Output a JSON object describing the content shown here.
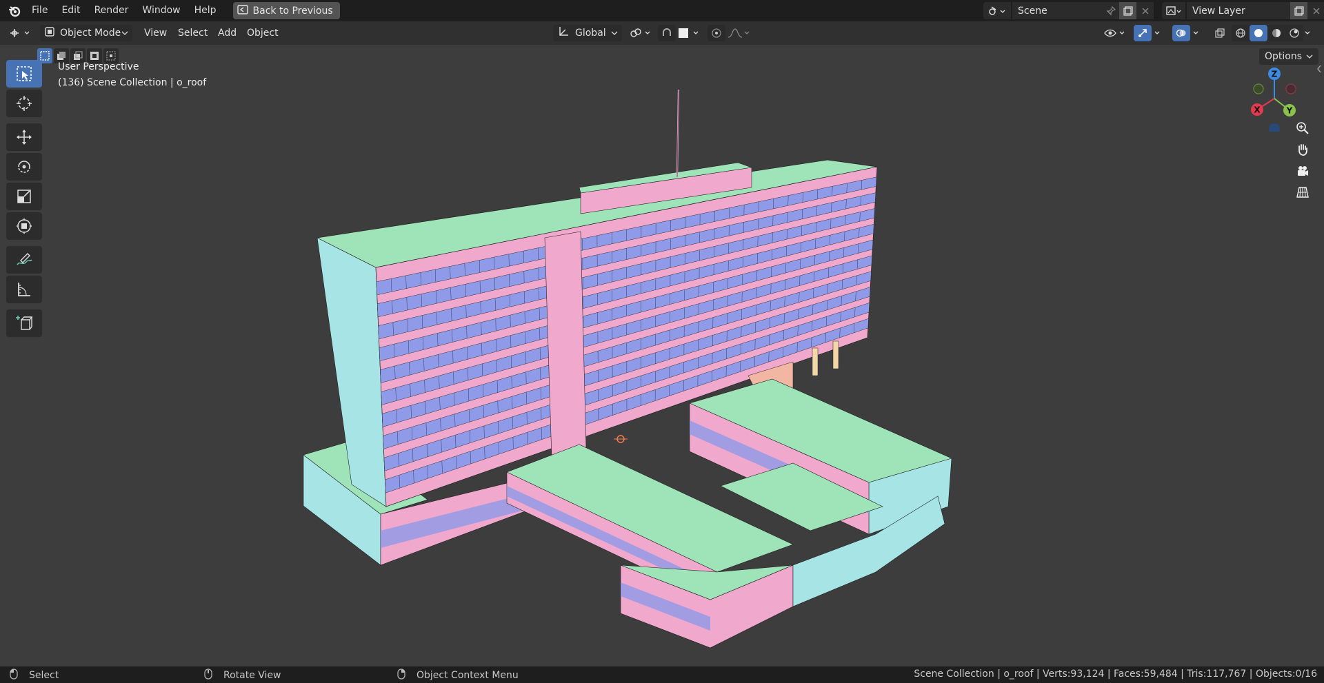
{
  "menu": {
    "items": [
      "File",
      "Edit",
      "Render",
      "Window",
      "Help"
    ],
    "back_label": "Back to Previous"
  },
  "scene": {
    "name": "Scene",
    "view_layer": "View Layer"
  },
  "header": {
    "mode": "Object Mode",
    "menus": [
      "View",
      "Select",
      "Add",
      "Object"
    ],
    "orientation": "Global",
    "options_label": "Options"
  },
  "viewport": {
    "perspective": "User Perspective",
    "collection_info": "(136) Scene Collection | o_roof"
  },
  "gizmo": {
    "x": "X",
    "y": "Y",
    "z": "Z",
    "colors": {
      "x": "#e33a4e",
      "y": "#8bc34a",
      "z": "#3d8be3"
    }
  },
  "status": {
    "select": "Select",
    "rotate": "Rotate View",
    "context": "Object Context Menu",
    "stats": "Scene Collection | o_roof | Verts:93,124 | Faces:59,484 | Tris:117,767 | Objects:0/16"
  },
  "colors": {
    "accent": "#4772b3",
    "roof": "#9fe3b8",
    "wall_pink": "#f0a8cc",
    "window_blue": "#8f9ae8",
    "side_cyan": "#a6e4e6"
  }
}
